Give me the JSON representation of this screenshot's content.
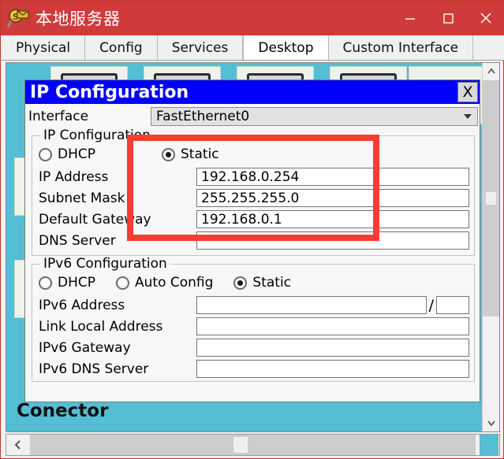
{
  "window": {
    "title": "本地服务器",
    "icon": "server-magnifier-icon",
    "titlebar_color": "#cf3b3b",
    "controls": {
      "minimize": "minimize-icon",
      "maximize": "maximize-icon",
      "close": "close-icon"
    }
  },
  "tabs": [
    {
      "label": "Physical",
      "active": false
    },
    {
      "label": "Config",
      "active": false
    },
    {
      "label": "Services",
      "active": false
    },
    {
      "label": "Desktop",
      "active": true
    },
    {
      "label": "Custom Interface",
      "active": false
    }
  ],
  "desktop": {
    "background_color": "#54bed4",
    "clipped_label": "Conector"
  },
  "dialog": {
    "title": "IP Configuration",
    "titlebar_color": "#0000ff",
    "close_label": "X",
    "interface": {
      "label": "Interface",
      "value": "FastEthernet0",
      "arrow": "chevron-down-icon"
    },
    "ipv4": {
      "group_title": "IP Configuration",
      "dhcp_label": "DHCP",
      "dhcp_selected": false,
      "static_label": "Static",
      "static_selected": true,
      "fields": [
        {
          "label": "IP Address",
          "value": "192.168.0.254"
        },
        {
          "label": "Subnet Mask",
          "value": "255.255.255.0"
        },
        {
          "label": "Default Gateway",
          "value": "192.168.0.1"
        },
        {
          "label": "DNS Server",
          "value": ""
        }
      ]
    },
    "ipv6": {
      "group_title": "IPv6 Configuration",
      "dhcp_label": "DHCP",
      "dhcp_selected": false,
      "auto_config_label": "Auto Config",
      "auto_config_selected": false,
      "static_label": "Static",
      "static_selected": true,
      "prefix_separator": "/",
      "fields": [
        {
          "label": "IPv6 Address",
          "value": ""
        },
        {
          "label": "Link Local Address",
          "value": ""
        },
        {
          "label": "IPv6 Gateway",
          "value": ""
        },
        {
          "label": "IPv6 DNS Server",
          "value": ""
        }
      ]
    }
  },
  "annotation": {
    "color": "#f93b31",
    "shape": "rectangle-highlight"
  },
  "scrollbars": {
    "vertical": {
      "up": "chevron-up-icon",
      "down": "chevron-down-icon"
    },
    "horizontal": {
      "left": "chevron-left-icon",
      "right": "chevron-right-icon"
    }
  }
}
